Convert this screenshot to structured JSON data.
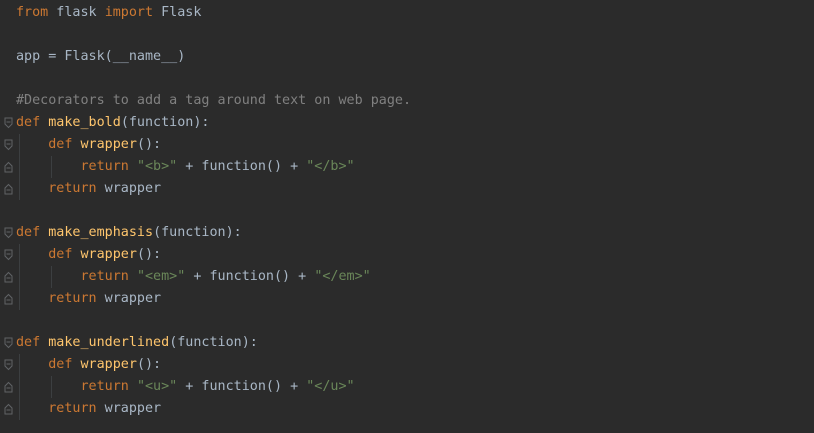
{
  "colors": {
    "background": "#2b2b2b",
    "keyword": "#cc7832",
    "function_name": "#ffc66d",
    "comment": "#808080",
    "string": "#6a8759",
    "default_text": "#a9b7c6"
  },
  "lines": [
    {
      "tokens": [
        {
          "t": "from",
          "c": "kw"
        },
        {
          "t": " flask ",
          "c": "tx"
        },
        {
          "t": "import",
          "c": "kw"
        },
        {
          "t": " Flask",
          "c": "tx"
        }
      ]
    },
    {
      "tokens": []
    },
    {
      "tokens": [
        {
          "t": "app = Flask(__name__)",
          "c": "tx"
        }
      ]
    },
    {
      "tokens": []
    },
    {
      "tokens": [
        {
          "t": "#Decorators to add a tag around text on web page.",
          "c": "cm"
        }
      ]
    },
    {
      "fold": "open",
      "tokens": [
        {
          "t": "def",
          "c": "kw"
        },
        {
          "t": " ",
          "c": "tx"
        },
        {
          "t": "make_bold",
          "c": "fn"
        },
        {
          "t": "(function):",
          "c": "tx"
        }
      ]
    },
    {
      "fold": "open",
      "guides": [
        0
      ],
      "tokens": [
        {
          "t": "    ",
          "c": "tx"
        },
        {
          "t": "def",
          "c": "kw"
        },
        {
          "t": " ",
          "c": "tx"
        },
        {
          "t": "wrapper",
          "c": "fn"
        },
        {
          "t": "():",
          "c": "tx"
        }
      ]
    },
    {
      "fold": "close",
      "guides": [
        0,
        1
      ],
      "tokens": [
        {
          "t": "        ",
          "c": "tx"
        },
        {
          "t": "return",
          "c": "kw"
        },
        {
          "t": " ",
          "c": "tx"
        },
        {
          "t": "\"<b>\"",
          "c": "st"
        },
        {
          "t": " + function() + ",
          "c": "tx"
        },
        {
          "t": "\"</b>\"",
          "c": "st"
        }
      ]
    },
    {
      "fold": "close",
      "guides": [
        0
      ],
      "tokens": [
        {
          "t": "    ",
          "c": "tx"
        },
        {
          "t": "return",
          "c": "kw"
        },
        {
          "t": " wrapper",
          "c": "tx"
        }
      ]
    },
    {
      "tokens": []
    },
    {
      "fold": "open",
      "tokens": [
        {
          "t": "def",
          "c": "kw"
        },
        {
          "t": " ",
          "c": "tx"
        },
        {
          "t": "make_emphasis",
          "c": "fn"
        },
        {
          "t": "(function):",
          "c": "tx"
        }
      ]
    },
    {
      "fold": "open",
      "guides": [
        0
      ],
      "tokens": [
        {
          "t": "    ",
          "c": "tx"
        },
        {
          "t": "def",
          "c": "kw"
        },
        {
          "t": " ",
          "c": "tx"
        },
        {
          "t": "wrapper",
          "c": "fn"
        },
        {
          "t": "():",
          "c": "tx"
        }
      ]
    },
    {
      "fold": "close",
      "guides": [
        0,
        1
      ],
      "tokens": [
        {
          "t": "        ",
          "c": "tx"
        },
        {
          "t": "return",
          "c": "kw"
        },
        {
          "t": " ",
          "c": "tx"
        },
        {
          "t": "\"<em>\"",
          "c": "st"
        },
        {
          "t": " + function() + ",
          "c": "tx"
        },
        {
          "t": "\"</em>\"",
          "c": "st"
        }
      ]
    },
    {
      "fold": "close",
      "guides": [
        0
      ],
      "tokens": [
        {
          "t": "    ",
          "c": "tx"
        },
        {
          "t": "return",
          "c": "kw"
        },
        {
          "t": " wrapper",
          "c": "tx"
        }
      ]
    },
    {
      "tokens": []
    },
    {
      "fold": "open",
      "tokens": [
        {
          "t": "def",
          "c": "kw"
        },
        {
          "t": " ",
          "c": "tx"
        },
        {
          "t": "make_underlined",
          "c": "fn"
        },
        {
          "t": "(function):",
          "c": "tx"
        }
      ]
    },
    {
      "fold": "open",
      "guides": [
        0
      ],
      "tokens": [
        {
          "t": "    ",
          "c": "tx"
        },
        {
          "t": "def",
          "c": "kw"
        },
        {
          "t": " ",
          "c": "tx"
        },
        {
          "t": "wrapper",
          "c": "fn"
        },
        {
          "t": "():",
          "c": "tx"
        }
      ]
    },
    {
      "fold": "close",
      "guides": [
        0,
        1
      ],
      "tokens": [
        {
          "t": "        ",
          "c": "tx"
        },
        {
          "t": "return",
          "c": "kw"
        },
        {
          "t": " ",
          "c": "tx"
        },
        {
          "t": "\"<u>\"",
          "c": "st"
        },
        {
          "t": " + function() + ",
          "c": "tx"
        },
        {
          "t": "\"</u>\"",
          "c": "st"
        }
      ]
    },
    {
      "fold": "close",
      "guides": [
        0
      ],
      "tokens": [
        {
          "t": "    ",
          "c": "tx"
        },
        {
          "t": "return",
          "c": "kw"
        },
        {
          "t": " wrapper",
          "c": "tx"
        }
      ]
    }
  ]
}
